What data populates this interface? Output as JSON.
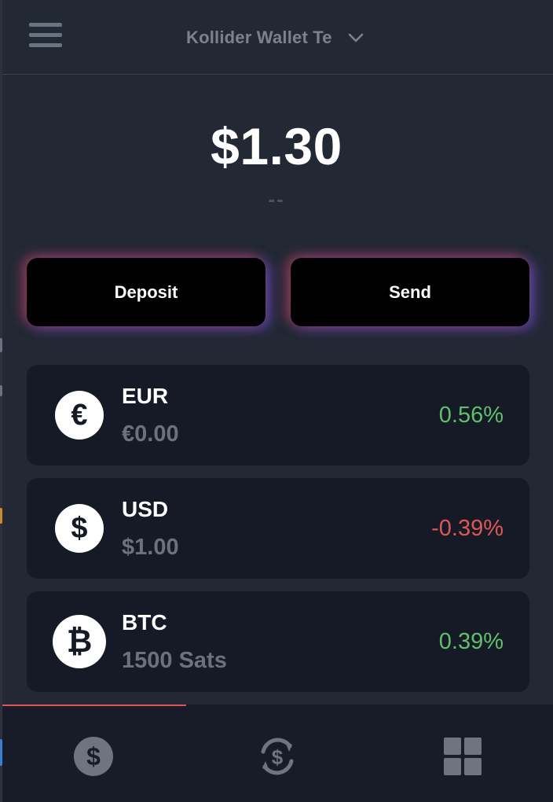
{
  "header": {
    "wallet_name": "Kollider Wallet Te"
  },
  "balance": {
    "total": "$1.30",
    "subtext": "--"
  },
  "actions": {
    "deposit_label": "Deposit",
    "send_label": "Send"
  },
  "currencies": [
    {
      "code": "EUR",
      "symbol": "€",
      "amount": "€0.00",
      "change": "0.56%",
      "trend": "up"
    },
    {
      "code": "USD",
      "symbol": "$",
      "amount": "$1.00",
      "change": "-0.39%",
      "trend": "down"
    },
    {
      "code": "BTC",
      "symbol": "₿",
      "amount": "1500 Sats",
      "change": "0.39%",
      "trend": "up"
    }
  ],
  "nav": {
    "items": [
      "dollar-icon",
      "exchange-icon",
      "grid-icon"
    ],
    "active_index": 0
  },
  "colors": {
    "background": "#222834",
    "card": "#151a26",
    "positive": "#5fbf6a",
    "negative": "#e05656",
    "accent": "#e0525a"
  }
}
